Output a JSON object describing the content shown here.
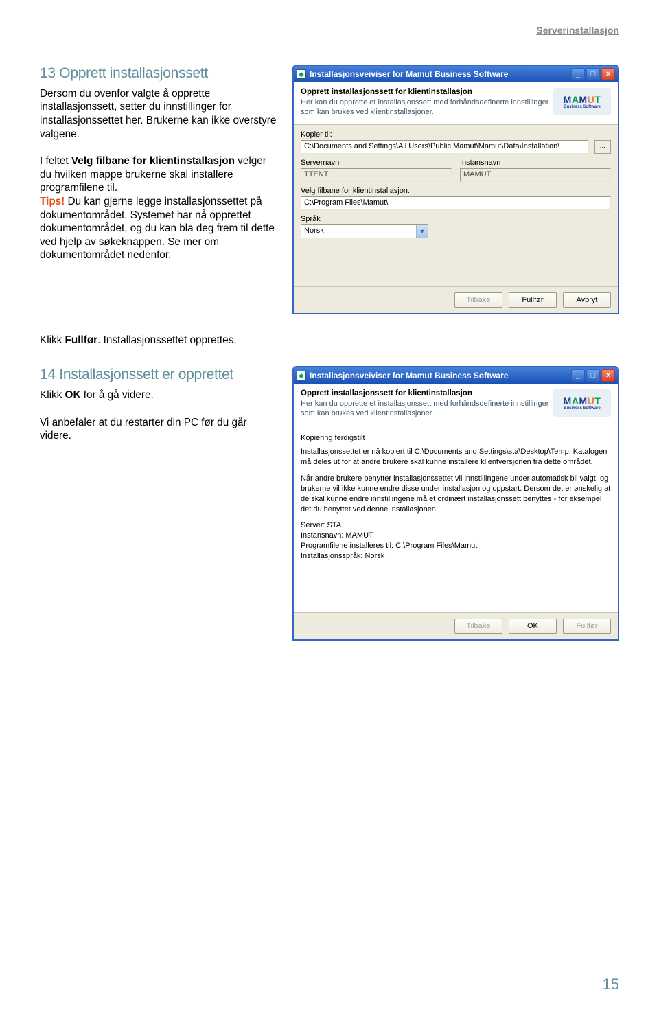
{
  "header": {
    "category": "Serverinstallasjon"
  },
  "section13": {
    "heading": "13 Opprett installasjonssett",
    "p1": "Dersom du ovenfor valgte å opprette installasjonssett, setter du innstillinger for installasjonssettet her. Brukerne kan ikke overstyre valgene.",
    "p2_a": "I feltet ",
    "p2_bold": "Velg filbane for klientinstallasjon",
    "p2_b": " velger du hvilken mappe brukerne skal installere programfilene til.",
    "tips_label": "Tips!",
    "tips_text": " Du kan gjerne legge installasjonssettet på dokumentområdet. Systemet har nå opprettet dokumentområdet, og du kan bla deg frem til dette ved hjelp av søkeknappen. Se mer om dokumentområdet nedenfor.",
    "p3_a": "Klikk ",
    "p3_bold": "Fullfør",
    "p3_b": ". Installasjonssettet opprettes."
  },
  "section14": {
    "heading": "14 Installasjonssett er opprettet",
    "p1_a": "Klikk ",
    "p1_bold": "OK",
    "p1_b": " for å gå videre.",
    "p2": "Vi anbefaler at du restarter din PC før du går videre."
  },
  "win1": {
    "title": "Installasjonsveiviser for Mamut Business Software",
    "logo_sub": "Business Software",
    "head_title": "Opprett installasjonssett for klientinstallasjon",
    "head_desc": "Her kan du opprette et installasjonssett med forhåndsdefinerte innstillinger som kan brukes ved klientinstallasjoner.",
    "labels": {
      "kopier": "Kopier til:",
      "servernavn": "Servernavn",
      "instansnavn": "Instansnavn",
      "velg_filbane": "Velg filbane for klientinstallasjon:",
      "sprak": "Språk"
    },
    "values": {
      "kopier": "C:\\Documents and Settings\\All Users\\Public Mamut\\Mamut\\Data\\Installation\\",
      "servernavn": "TTENT",
      "instansnavn": "MAMUT",
      "filbane": "C:\\Program Files\\Mamut\\",
      "sprak": "Norsk"
    },
    "buttons": {
      "dot": "...",
      "tilbake": "Tilbake",
      "fullfor": "Fullfør",
      "avbryt": "Avbryt"
    }
  },
  "win2": {
    "title": "Installasjonsveiviser for Mamut Business Software",
    "head_title": "Opprett installasjonssett for klientinstallasjon",
    "head_desc": "Her kan du opprette et installasjonssett med forhåndsdefinerte innstillinger som kan brukes ved klientinstallasjoner.",
    "status_label": "Kopiering ferdigstilt",
    "p1": "Installasjonssettet er nå kopiert til C:\\Documents and Settings\\sta\\Desktop\\Temp. Katalogen må deles ut for at andre brukere skal kunne installere klientversjonen fra dette området.",
    "p2": "Når andre brukere benytter installasjonssettet vil innstillingene under automatisk bli valgt, og brukerne vil ikke kunne endre disse under installasjon og oppstart. Dersom det er ønskelig at de skal kunne endre innstillingene må et ordinært installasjonssett benyttes - for eksempel det du benyttet ved denne installasjonen.",
    "kv1": "Server: STA",
    "kv2": "Instansnavn: MAMUT",
    "kv3": "Programfilene installeres til: C:\\Program Files\\Mamut",
    "kv4": "Installasjonsspråk: Norsk",
    "buttons": {
      "tilbake": "Tilbake",
      "ok": "OK",
      "fullfor": "Fullfør"
    }
  },
  "page_number": "15"
}
